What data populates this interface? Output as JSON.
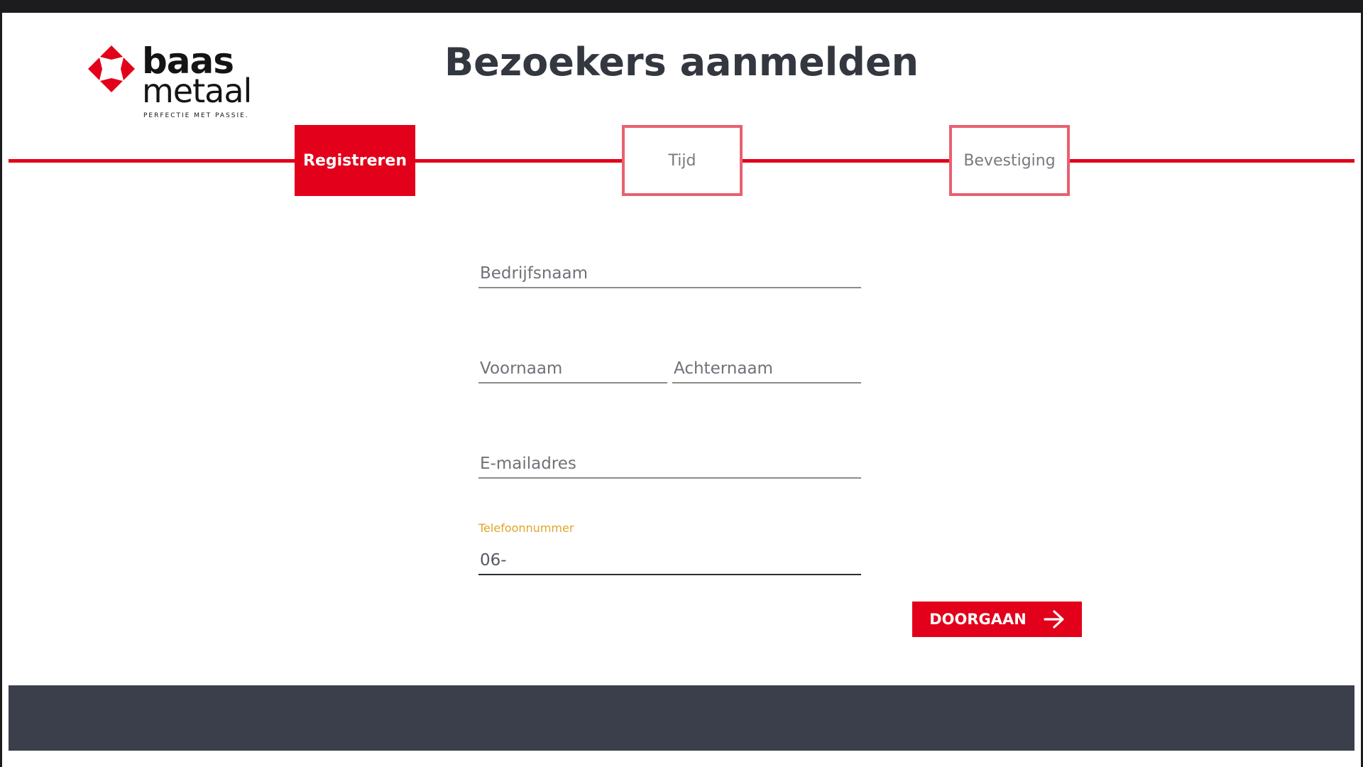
{
  "brand": {
    "name_line1": "baas",
    "name_line2": "metaal",
    "tagline": "PERFECTIE MET PASSIE."
  },
  "page": {
    "title": "Bezoekers aanmelden"
  },
  "steps": [
    {
      "label": "Registreren",
      "active": true
    },
    {
      "label": "Tijd",
      "active": false
    },
    {
      "label": "Bevestiging",
      "active": false
    }
  ],
  "form": {
    "company": {
      "placeholder": "Bedrijfsnaam",
      "value": ""
    },
    "first_name": {
      "placeholder": "Voornaam",
      "value": ""
    },
    "last_name": {
      "placeholder": "Achternaam",
      "value": ""
    },
    "email": {
      "placeholder": "E-mailadres",
      "value": ""
    },
    "phone": {
      "label": "Telefoonnummer",
      "value": "06-"
    }
  },
  "actions": {
    "continue_label": "DOORGAAN",
    "continue_icon": "arrow-right-icon"
  },
  "colors": {
    "brand_red": "#e2001a",
    "inactive_step_border": "#e86170",
    "footer": "#3b3f4b",
    "focus_label": "#e0a52a",
    "title": "#33373f"
  }
}
